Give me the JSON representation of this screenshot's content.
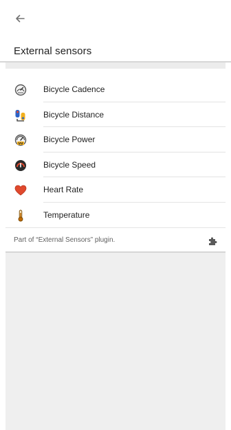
{
  "header": {
    "back_icon": "arrow-back-icon",
    "title": "External sensors"
  },
  "sensors": [
    {
      "label": "Bicycle Cadence",
      "icon": "cadence-gauge-icon"
    },
    {
      "label": "Bicycle Distance",
      "icon": "distance-icon"
    },
    {
      "label": "Bicycle Power",
      "icon": "power-gauge-icon"
    },
    {
      "label": "Bicycle Speed",
      "icon": "speedometer-icon"
    },
    {
      "label": "Heart Rate",
      "icon": "heart-icon"
    },
    {
      "label": "Temperature",
      "icon": "thermometer-icon"
    }
  ],
  "footer": {
    "note": "Part of “External Sensors” plugin.",
    "plugin_icon": "puzzle-piece-icon"
  },
  "colors": {
    "accent_gray": "#727272",
    "heart": "#e0492d",
    "thermometer": "#c26b00",
    "divider": "#e3e3e3",
    "empty_area": "#efefef"
  }
}
